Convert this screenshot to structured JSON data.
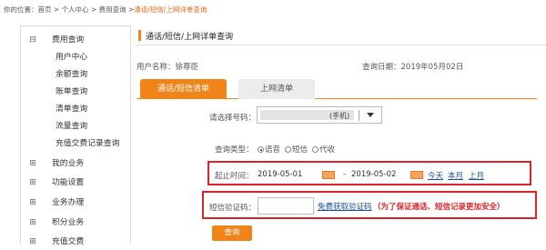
{
  "breadcrumb": {
    "label": "你的位置：",
    "home": "首页",
    "sep": " > ",
    "center": "个人中心",
    "fee": "费用查询",
    "current": "通话/短信/上网详单查询"
  },
  "sidebar": {
    "items": [
      {
        "toggle": "⊟",
        "label": "费用查询"
      },
      {
        "label": "用户中心"
      },
      {
        "label": "余额查询"
      },
      {
        "label": "账单查询"
      },
      {
        "label": "清单查询"
      },
      {
        "label": "流量查询"
      },
      {
        "label": "充值交费记录查询"
      },
      {
        "toggle": "⊞",
        "label": "我的业务"
      },
      {
        "toggle": "⊞",
        "label": "功能设置"
      },
      {
        "toggle": "⊞",
        "label": "业务办理"
      },
      {
        "toggle": "⊞",
        "label": "积分业务"
      },
      {
        "toggle": "⊞",
        "label": "充值交费"
      }
    ]
  },
  "header": {
    "title": "通话/短信/上网详单查询"
  },
  "info": {
    "user_label": "用户名称：",
    "user_name": "徐尊臣",
    "date_label": "查询日期：",
    "date": "2019年05月02日"
  },
  "tabs": [
    {
      "label": "通话/短信清单",
      "active": true
    },
    {
      "label": "上网清单",
      "active": false
    }
  ],
  "form": {
    "number_label": "请选择号码：",
    "number_suffix": "(手机)",
    "type_label": "查询类型：",
    "types": [
      {
        "label": "语音",
        "checked": true
      },
      {
        "label": "短信",
        "checked": false
      },
      {
        "label": "代收",
        "checked": false
      }
    ],
    "time_label": "起止时间：",
    "start_date": "2019-05-01",
    "end_date": "2019-05-02",
    "date_sep": "-",
    "quick": [
      "今天",
      "本月",
      "上月"
    ],
    "code_label": "短信验证码：",
    "get_code": "免费获取验证码",
    "warning": "（为了保证通话、短信记录更加安全）",
    "submit": "查询"
  },
  "colors": {
    "accent": "#f08418",
    "highlight": "#e0202a",
    "link": "#1a4e9c"
  }
}
